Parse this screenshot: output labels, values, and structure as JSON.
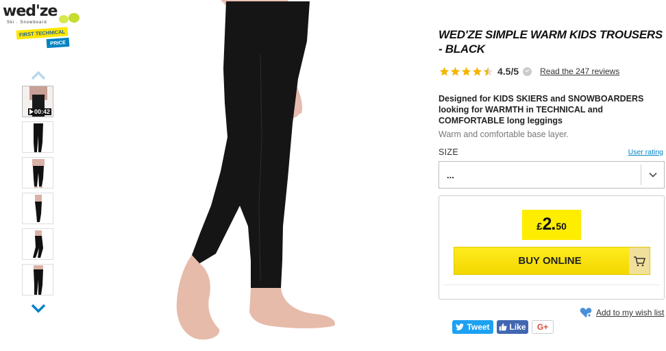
{
  "logo": {
    "brand": "wed'ze",
    "tagline": "Ski . Snowboard",
    "badge_line1": "FIRST TECHNICAL",
    "badge_line2": "PRICE"
  },
  "thumbnails": [
    {
      "kind": "video",
      "duration": "00:42"
    },
    {
      "kind": "image"
    },
    {
      "kind": "image"
    },
    {
      "kind": "image"
    },
    {
      "kind": "image"
    },
    {
      "kind": "image"
    }
  ],
  "product": {
    "title": "WED'ZE SIMPLE WARM KIDS TROUSERS - BLACK",
    "rating": {
      "value": 4.5,
      "label": "4.5/5",
      "stars_filled": 4.5,
      "stars_total": 5
    },
    "reviews_link": "Read the 247 reviews",
    "description_bold": "Designed for KIDS SKIERS and SNOWBOARDERS looking for WARMTH in TECHNICAL and COMFORTABLE long leggings",
    "description_light": "Warm and comfortable base layer."
  },
  "size": {
    "label": "SIZE",
    "user_rating_link": "User rating",
    "selected": "..."
  },
  "price": {
    "currency": "£",
    "integer": "2.",
    "decimal": "50"
  },
  "buy": {
    "label": "BUY ONLINE"
  },
  "wishlist": {
    "label": "Add to my wish list"
  },
  "social": {
    "tweet": "Tweet",
    "like": "Like",
    "gplus": "G+"
  },
  "colors": {
    "accent_yellow": "#ffed00",
    "link_blue": "#0082c3",
    "star": "#f4b400",
    "twitter": "#1da1f2",
    "facebook": "#4267b2"
  }
}
